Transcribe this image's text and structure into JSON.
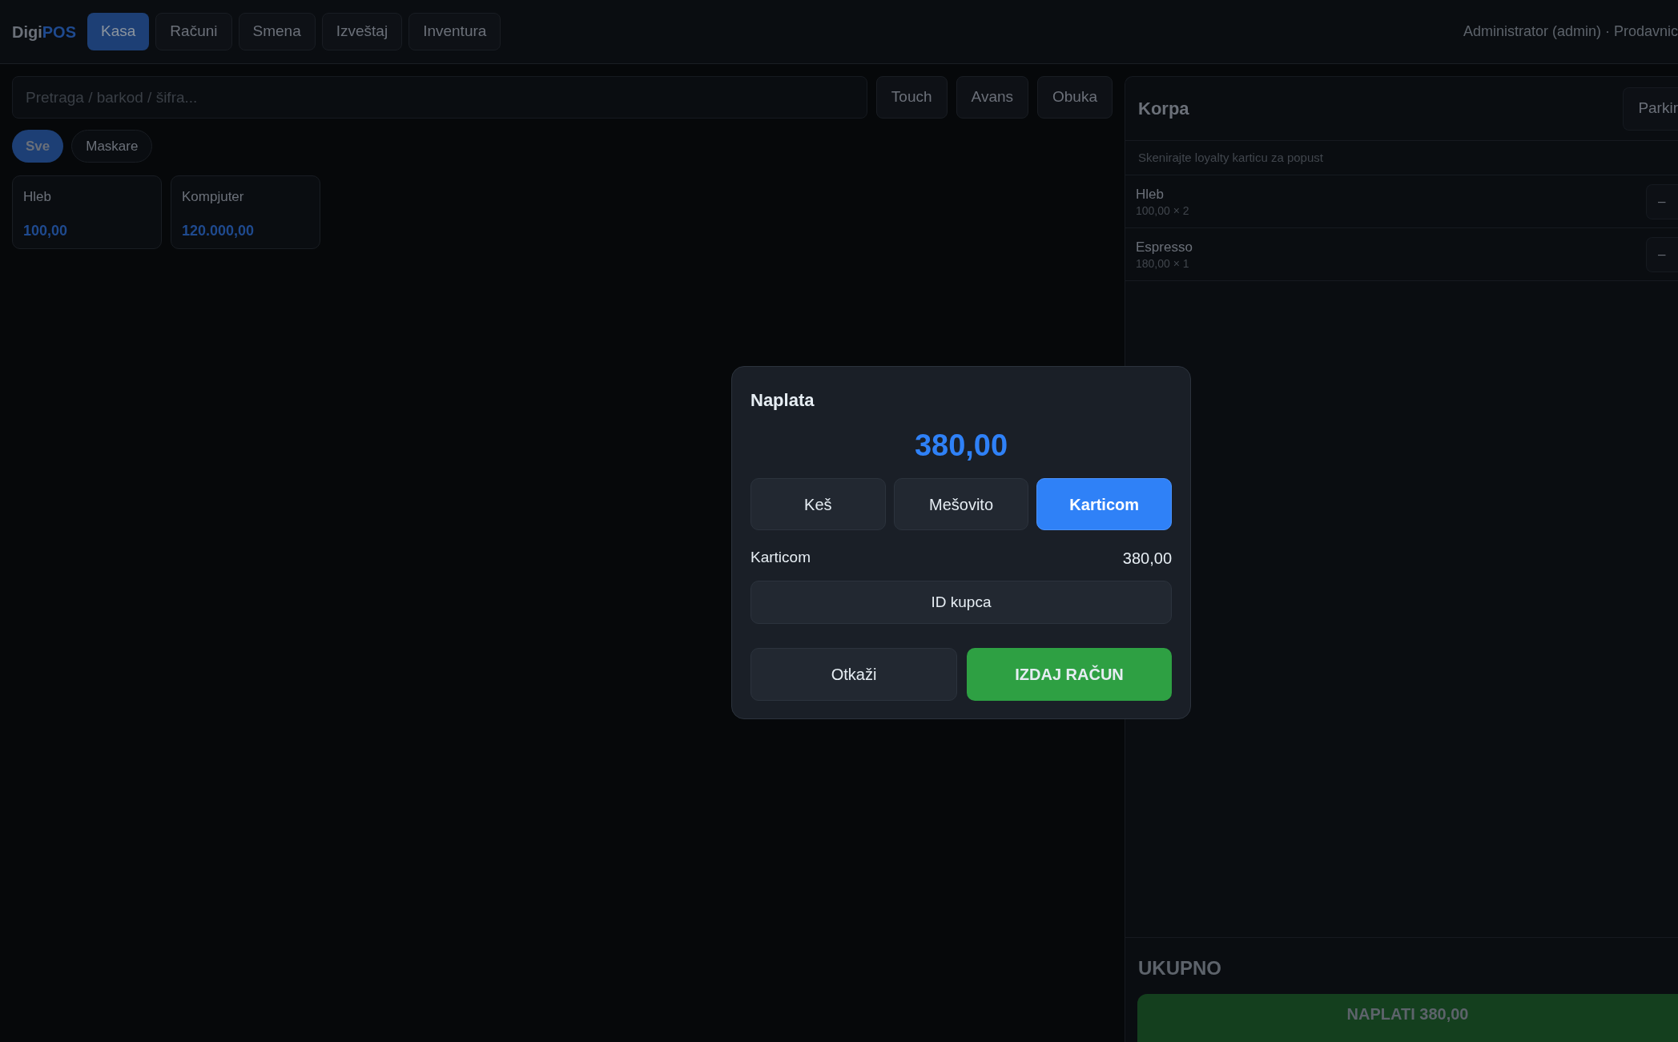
{
  "top_bar": {
    "logo": {
      "first": "Digi",
      "second": "POS"
    },
    "tabs": [
      {
        "label": "Kasa",
        "selected": true
      },
      {
        "label": "Računi",
        "selected": false
      },
      {
        "label": "Smena",
        "selected": false
      },
      {
        "label": "Izveštaj",
        "selected": false
      },
      {
        "label": "Inventura",
        "selected": false
      }
    ],
    "user_info": "Administrator (admin) · Prodavnic"
  },
  "search": {
    "placeholder": "Pretraga / barkod / šifra..."
  },
  "mode_buttons": [
    "Touch",
    "Avans",
    "Obuka"
  ],
  "categories": [
    {
      "label": "Sve",
      "selected": true
    },
    {
      "label": "Maskare",
      "selected": false
    }
  ],
  "products": [
    {
      "name": "Hleb",
      "price": "100,00"
    },
    {
      "name": "Kompjuter",
      "price": "120.000,00"
    }
  ],
  "cart": {
    "title": "Korpa",
    "park_button": "Parkir",
    "loyalty_hint": "Skenirajte loyalty karticu za popust",
    "items": [
      {
        "name": "Hleb",
        "detail": "100,00 × 2",
        "minus": "–"
      },
      {
        "name": "Espresso",
        "detail": "180,00 × 1",
        "minus": "–"
      }
    ],
    "total_label": "UKUPNO",
    "pay_button": "NAPLATI 380,00"
  },
  "dialog": {
    "title": "Naplata",
    "amount": "380,00",
    "methods": [
      {
        "label": "Keš",
        "selected": false
      },
      {
        "label": "Mešovito",
        "selected": false
      },
      {
        "label": "Karticom",
        "selected": true
      }
    ],
    "summary_label": "Karticom",
    "summary_value": "380,00",
    "customer_id_button": "ID kupca",
    "cancel_button": "Otkaži",
    "issue_button": "IZDAJ RAČUN"
  }
}
